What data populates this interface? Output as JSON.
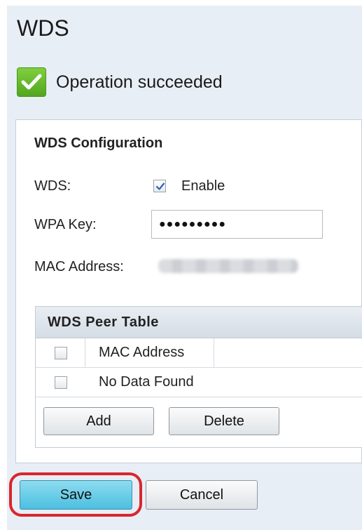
{
  "page": {
    "title": "WDS"
  },
  "status": {
    "message": "Operation succeeded",
    "icon": "checkmark-icon",
    "color": "#5cb528"
  },
  "config": {
    "section_title": "WDS Configuration",
    "wds_label": "WDS:",
    "enable_label": "Enable",
    "enable_checked": true,
    "wpa_label": "WPA Key:",
    "wpa_value": "●●●●●●●●●",
    "mac_label": "MAC Address:"
  },
  "peer_table": {
    "title": "WDS Peer Table",
    "columns": [
      "MAC Address"
    ],
    "empty_message": "No Data Found",
    "add_label": "Add",
    "delete_label": "Delete"
  },
  "footer": {
    "save_label": "Save",
    "cancel_label": "Cancel",
    "highlight_color": "#d9262c"
  }
}
